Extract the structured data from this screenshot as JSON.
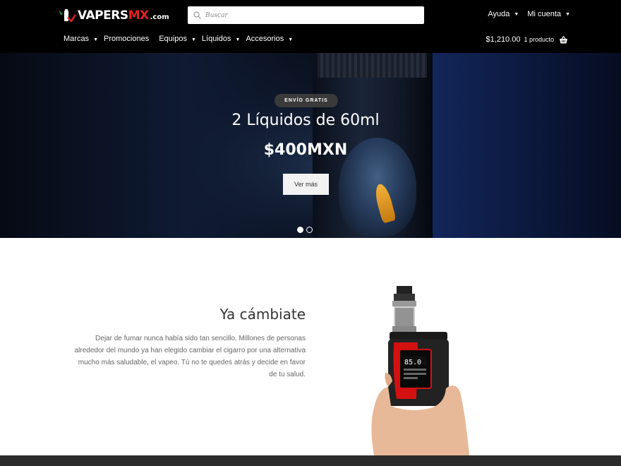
{
  "header": {
    "logo": {
      "main": "VAPERS",
      "accent": "MX",
      "suffix": ".com"
    },
    "search": {
      "placeholder": "Buscar"
    },
    "top_links": [
      {
        "label": "Ayuda"
      },
      {
        "label": "Mi cuenta"
      }
    ],
    "nav": [
      {
        "label": "Marcas",
        "has_dropdown": true
      },
      {
        "label": "Promociones",
        "has_dropdown": false
      },
      {
        "label": "Equipos",
        "has_dropdown": true
      },
      {
        "label": "Líquidos",
        "has_dropdown": true
      },
      {
        "label": "Accesorios",
        "has_dropdown": true
      }
    ],
    "cart": {
      "total": "$1,210.00",
      "count": "1 producto"
    }
  },
  "hero": {
    "badge": "ENVÍO GRATIS",
    "title": "2 Líquidos de 60ml",
    "price": "$400MXN",
    "button": "Ver más",
    "slides": 2,
    "active_slide": 1
  },
  "promo": {
    "title": "Ya cámbiate",
    "text": "Dejar de fumar nunca había sido tan sencillo. Millones de personas alrededor del mundo ya han elegido cambiar el cigarro por una alternativa mucho más saludable, el vapeo. Tú no te quedes atrás y decide en favor de tu salud.",
    "device_screen": "85.0"
  },
  "colors": {
    "header_bg": "#000000",
    "accent": "#e02020",
    "footer": "#2b2b2b"
  }
}
